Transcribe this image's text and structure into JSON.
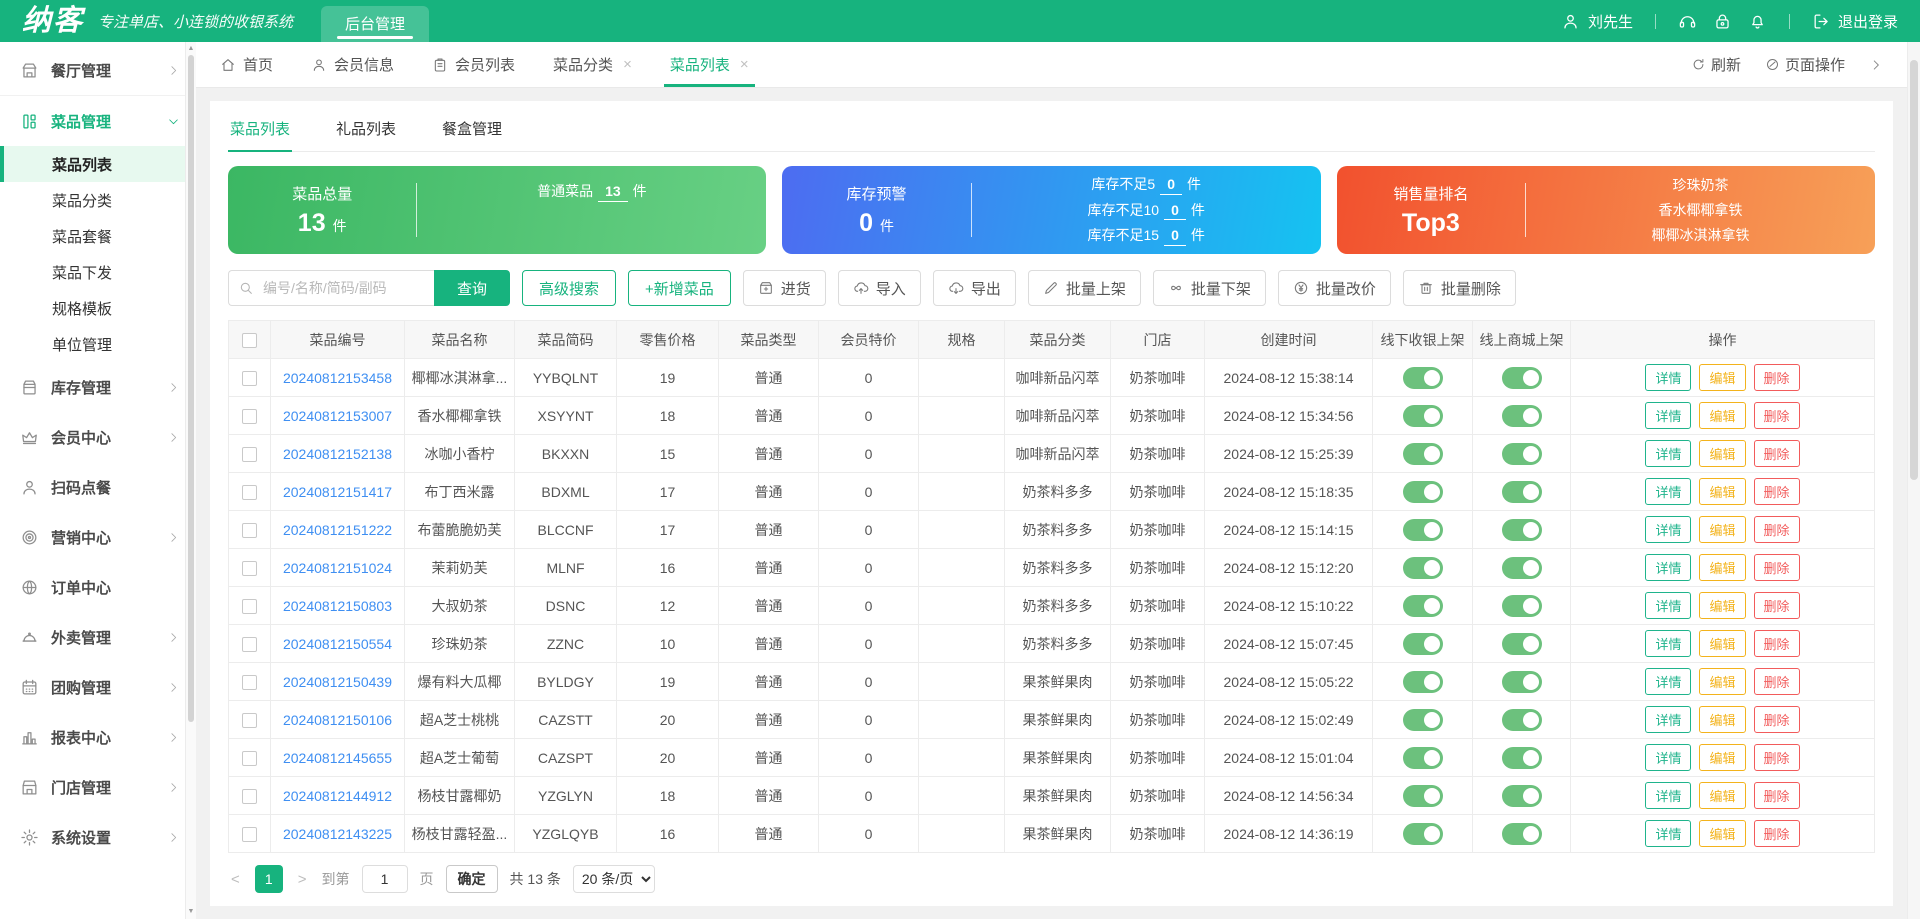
{
  "header": {
    "logo": "纳客",
    "tagline": "专注单店、小连锁的收银系统",
    "nav_tab": "后台管理",
    "user": "刘先生",
    "logout": "退出登录"
  },
  "colors": {
    "brand_green": "#17b37e",
    "link_blue": "#3f8ff2",
    "toggle_green": "#6cc17d",
    "detail_teal": "#1fb48c",
    "edit_amber": "#f3b31c",
    "delete_red": "#f25b5b",
    "card_green_start": "#3bb763",
    "card_green_end": "#68d084",
    "card_blue_start": "#4d6cf1",
    "card_blue_end": "#15c3f1",
    "card_orange_start": "#f2512e",
    "card_orange_end": "#f7a058"
  },
  "sidebar": {
    "items": [
      {
        "key": "restaurant",
        "label": "餐厅管理",
        "icon": "restaurant-icon",
        "type": "group",
        "chevron": "right"
      },
      {
        "key": "dish",
        "label": "菜品管理",
        "icon": "dishes-icon",
        "type": "group",
        "chevron": "down",
        "active": true
      },
      {
        "key": "dish-list",
        "label": "菜品列表",
        "type": "sub",
        "active": true
      },
      {
        "key": "dish-category",
        "label": "菜品分类",
        "type": "sub"
      },
      {
        "key": "dish-combo",
        "label": "菜品套餐",
        "type": "sub"
      },
      {
        "key": "dish-dispatch",
        "label": "菜品下发",
        "type": "sub"
      },
      {
        "key": "spec-template",
        "label": "规格模板",
        "type": "sub"
      },
      {
        "key": "unit-management",
        "label": "单位管理",
        "type": "sub"
      },
      {
        "key": "inventory",
        "label": "库存管理",
        "icon": "inventory-icon",
        "type": "group",
        "chevron": "right"
      },
      {
        "key": "member-center",
        "label": "会员中心",
        "icon": "member-icon",
        "type": "group",
        "chevron": "right"
      },
      {
        "key": "scan-order",
        "label": "扫码点餐",
        "icon": "scan-order-icon",
        "type": "group"
      },
      {
        "key": "marketing",
        "label": "营销中心",
        "icon": "marketing-icon",
        "type": "group",
        "chevron": "right"
      },
      {
        "key": "order-center",
        "label": "订单中心",
        "icon": "order-icon",
        "type": "group"
      },
      {
        "key": "takeout",
        "label": "外卖管理",
        "icon": "takeout-icon",
        "type": "group",
        "chevron": "right"
      },
      {
        "key": "groupbuy",
        "label": "团购管理",
        "icon": "groupbuy-icon",
        "type": "group",
        "chevron": "right"
      },
      {
        "key": "report",
        "label": "报表中心",
        "icon": "report-icon",
        "type": "group",
        "chevron": "right"
      },
      {
        "key": "store",
        "label": "门店管理",
        "icon": "store-icon",
        "type": "group",
        "chevron": "right"
      },
      {
        "key": "settings",
        "label": "系统设置",
        "icon": "settings-icon",
        "type": "group",
        "chevron": "right"
      }
    ]
  },
  "tabbar": {
    "tabs": [
      {
        "key": "home",
        "label": "首页",
        "icon": "home-icon"
      },
      {
        "key": "member-info",
        "label": "会员信息",
        "icon": "user-icon"
      },
      {
        "key": "member-list",
        "label": "会员列表",
        "icon": "list-icon"
      },
      {
        "key": "dish-category",
        "label": "菜品分类",
        "closable": true
      },
      {
        "key": "dish-list",
        "label": "菜品列表",
        "closable": true,
        "active": true
      }
    ],
    "refresh": "刷新",
    "page_ops": "页面操作"
  },
  "subtabs": [
    {
      "key": "dish-list",
      "label": "菜品列表",
      "active": true
    },
    {
      "key": "gift-list",
      "label": "礼品列表"
    },
    {
      "key": "mealbox",
      "label": "餐盒管理"
    }
  ],
  "stats": {
    "total": {
      "title": "菜品总量",
      "value": "13",
      "unit": "件",
      "side_label": "普通菜品",
      "side_value": "13",
      "side_unit": "件"
    },
    "stock": {
      "title": "库存预警",
      "value": "0",
      "unit": "件",
      "rows": [
        {
          "label": "库存不足5",
          "value": "0",
          "unit": "件"
        },
        {
          "label": "库存不足10",
          "value": "0",
          "unit": "件"
        },
        {
          "label": "库存不足15",
          "value": "0",
          "unit": "件"
        }
      ]
    },
    "sales": {
      "title": "销售量排名",
      "value": "Top3",
      "items": [
        "珍珠奶茶",
        "香水椰椰拿铁",
        "椰椰冰淇淋拿铁"
      ]
    }
  },
  "toolbar": {
    "search_placeholder": "编号/名称/简码/副码",
    "query_label": "查询",
    "advanced_label": "高级搜索",
    "add_label": "+新增菜品",
    "batch_buttons": [
      {
        "key": "purchase",
        "label": "进货",
        "icon": "purchase-icon"
      },
      {
        "key": "import",
        "label": "导入",
        "icon": "import-icon"
      },
      {
        "key": "export",
        "label": "导出",
        "icon": "export-icon"
      },
      {
        "key": "batch-on",
        "label": "批量上架",
        "icon": "pencil-icon"
      },
      {
        "key": "batch-off",
        "label": "批量下架",
        "icon": "unlink-icon"
      },
      {
        "key": "batch-price",
        "label": "批量改价",
        "icon": "yen-icon"
      },
      {
        "key": "batch-delete",
        "label": "批量删除",
        "icon": "trash-icon"
      }
    ]
  },
  "table": {
    "columns": [
      "菜品编号",
      "菜品名称",
      "菜品简码",
      "零售价格",
      "菜品类型",
      "会员特价",
      "规格",
      "菜品分类",
      "门店",
      "创建时间",
      "线下收银上架",
      "线上商城上架",
      "操作"
    ],
    "action_labels": {
      "detail": "详情",
      "edit": "编辑",
      "delete": "删除"
    },
    "rows": [
      {
        "id": "20240812153458",
        "name": "椰椰冰淇淋拿...",
        "code": "YYBQLNT",
        "price": "19",
        "type": "普通",
        "member_price": "0",
        "spec": "",
        "category": "咖啡新品闪萃",
        "store": "奶茶咖啡",
        "created": "2024-08-12 15:38:14",
        "offline": true,
        "online": true
      },
      {
        "id": "20240812153007",
        "name": "香水椰椰拿铁",
        "code": "XSYYNT",
        "price": "18",
        "type": "普通",
        "member_price": "0",
        "spec": "",
        "category": "咖啡新品闪萃",
        "store": "奶茶咖啡",
        "created": "2024-08-12 15:34:56",
        "offline": true,
        "online": true
      },
      {
        "id": "20240812152138",
        "name": "冰咖小香柠",
        "code": "BKXXN",
        "price": "15",
        "type": "普通",
        "member_price": "0",
        "spec": "",
        "category": "咖啡新品闪萃",
        "store": "奶茶咖啡",
        "created": "2024-08-12 15:25:39",
        "offline": true,
        "online": true
      },
      {
        "id": "20240812151417",
        "name": "布丁西米露",
        "code": "BDXML",
        "price": "17",
        "type": "普通",
        "member_price": "0",
        "spec": "",
        "category": "奶茶料多多",
        "store": "奶茶咖啡",
        "created": "2024-08-12 15:18:35",
        "offline": true,
        "online": true
      },
      {
        "id": "20240812151222",
        "name": "布蕾脆脆奶芙",
        "code": "BLCCNF",
        "price": "17",
        "type": "普通",
        "member_price": "0",
        "spec": "",
        "category": "奶茶料多多",
        "store": "奶茶咖啡",
        "created": "2024-08-12 15:14:15",
        "offline": true,
        "online": true
      },
      {
        "id": "20240812151024",
        "name": "茉莉奶芙",
        "code": "MLNF",
        "price": "16",
        "type": "普通",
        "member_price": "0",
        "spec": "",
        "category": "奶茶料多多",
        "store": "奶茶咖啡",
        "created": "2024-08-12 15:12:20",
        "offline": true,
        "online": true
      },
      {
        "id": "20240812150803",
        "name": "大叔奶茶",
        "code": "DSNC",
        "price": "12",
        "type": "普通",
        "member_price": "0",
        "spec": "",
        "category": "奶茶料多多",
        "store": "奶茶咖啡",
        "created": "2024-08-12 15:10:22",
        "offline": true,
        "online": true
      },
      {
        "id": "20240812150554",
        "name": "珍珠奶茶",
        "code": "ZZNC",
        "price": "10",
        "type": "普通",
        "member_price": "0",
        "spec": "",
        "category": "奶茶料多多",
        "store": "奶茶咖啡",
        "created": "2024-08-12 15:07:45",
        "offline": true,
        "online": true
      },
      {
        "id": "20240812150439",
        "name": "爆有料大瓜椰",
        "code": "BYLDGY",
        "price": "19",
        "type": "普通",
        "member_price": "0",
        "spec": "",
        "category": "果茶鲜果肉",
        "store": "奶茶咖啡",
        "created": "2024-08-12 15:05:22",
        "offline": true,
        "online": true
      },
      {
        "id": "20240812150106",
        "name": "超A芝士桃桃",
        "code": "CAZSTT",
        "price": "20",
        "type": "普通",
        "member_price": "0",
        "spec": "",
        "category": "果茶鲜果肉",
        "store": "奶茶咖啡",
        "created": "2024-08-12 15:02:49",
        "offline": true,
        "online": true
      },
      {
        "id": "20240812145655",
        "name": "超A芝士葡萄",
        "code": "CAZSPT",
        "price": "20",
        "type": "普通",
        "member_price": "0",
        "spec": "",
        "category": "果茶鲜果肉",
        "store": "奶茶咖啡",
        "created": "2024-08-12 15:01:04",
        "offline": true,
        "online": true
      },
      {
        "id": "20240812144912",
        "name": "杨枝甘露椰奶",
        "code": "YZGLYN",
        "price": "18",
        "type": "普通",
        "member_price": "0",
        "spec": "",
        "category": "果茶鲜果肉",
        "store": "奶茶咖啡",
        "created": "2024-08-12 14:56:34",
        "offline": true,
        "online": true
      },
      {
        "id": "20240812143225",
        "name": "杨枝甘露轻盈...",
        "code": "YZGLQYB",
        "price": "16",
        "type": "普通",
        "member_price": "0",
        "spec": "",
        "category": "果茶鲜果肉",
        "store": "奶茶咖啡",
        "created": "2024-08-12 14:36:19",
        "offline": true,
        "online": true
      }
    ]
  },
  "pagination": {
    "current_page": "1",
    "goto_prefix": "到第",
    "goto_value": "1",
    "goto_suffix": "页",
    "confirm": "确定",
    "total": "共 13 条",
    "page_size": "20 条/页"
  }
}
